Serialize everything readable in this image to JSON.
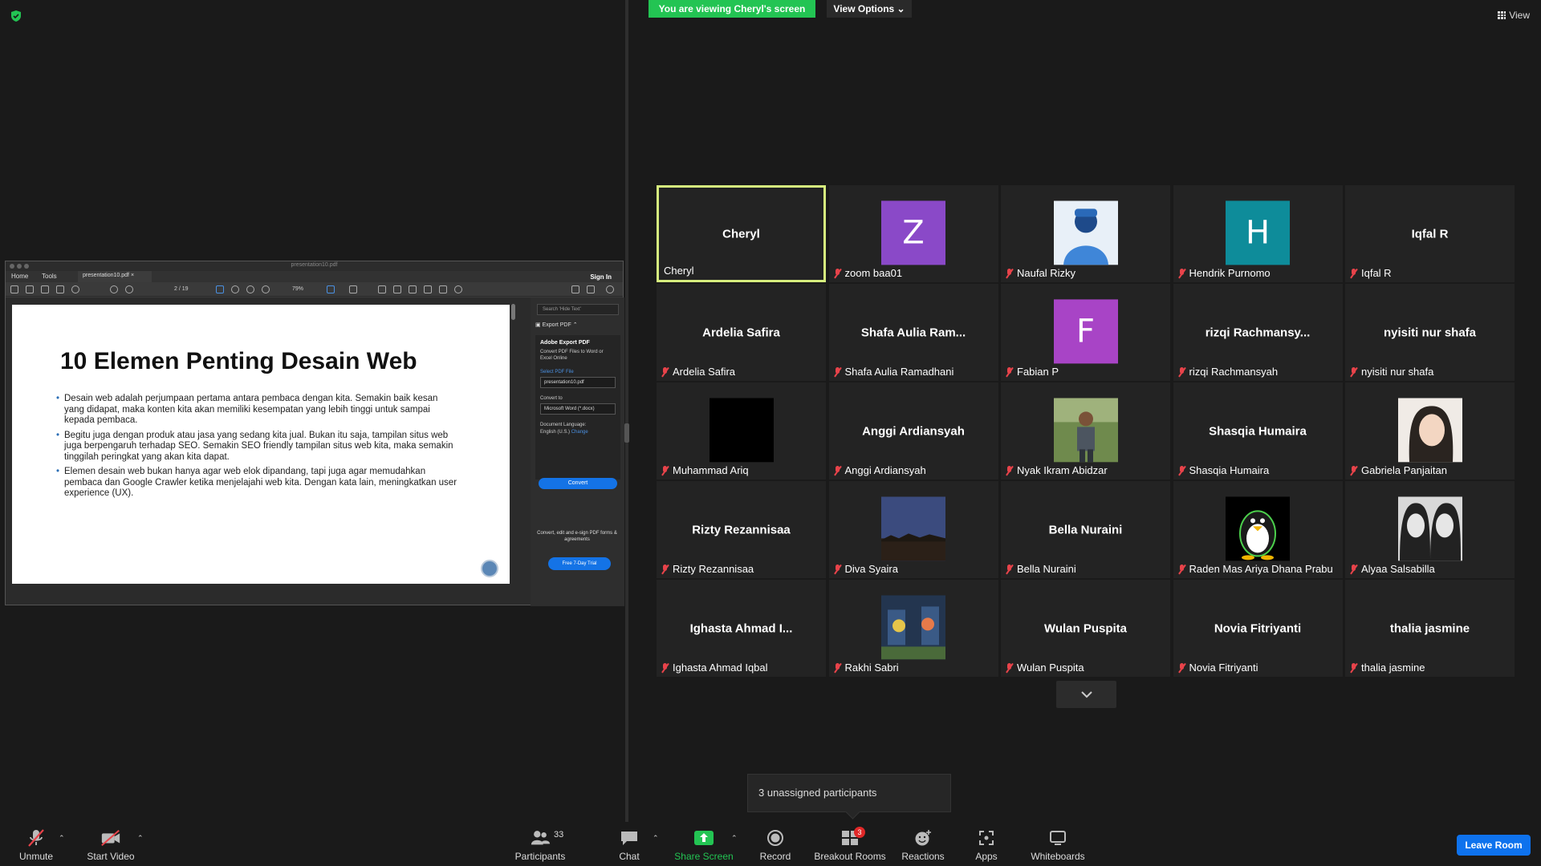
{
  "banner": {
    "viewing": "You are viewing Cheryl's screen",
    "view_options": "View Options ⌄",
    "view": "View"
  },
  "acrobat": {
    "window_title": "presentation10.pdf",
    "tabs": {
      "home": "Home",
      "tools": "Tools",
      "doc": "presentation10.pdf",
      "sign_in": "Sign In"
    },
    "page_num": "2 / 19",
    "zoom": "79%",
    "pdf": {
      "title": "10 Elemen Penting Desain Web",
      "bullets": [
        "Desain web adalah perjumpaan pertama antara pembaca dengan kita. Semakin baik kesan yang didapat, maka konten  kita akan memiliki kesempatan yang lebih tinggi untuk sampai kepada pembaca.",
        "Begitu juga dengan produk atau jasa yang sedang kita jual. Bukan itu saja, tampilan situs web juga berpengaruh terhadap SEO. Semakin SEO friendly tampilan situs web kita, maka semakin tinggilah peringkat yang akan kita dapat.",
        "Elemen desain web bukan hanya agar web elok dipandang, tapi juga agar memudahkan pembaca dan Google Crawler ketika menjelajahi web kita. Dengan kata lain, meningkatkan user experience (UX)."
      ]
    },
    "side": {
      "search_placeholder": "Search 'Hide Text'",
      "export_head": "Export PDF",
      "panel_title": "Adobe Export PDF",
      "panel_desc": "Convert PDF Files to Word or Excel Online",
      "select_label": "Select PDF File",
      "file": "presentation10.pdf",
      "convert_to_label": "Convert to",
      "convert_to": "Microsoft Word (*.docx)",
      "doc_lang_label": "Document Language:",
      "doc_lang": "English (U.S.)",
      "change": "Change",
      "convert_btn": "Convert",
      "promo": "Convert, edit and e-sign PDF forms & agreements",
      "trial_btn": "Free 7-Day Trial"
    }
  },
  "participants": [
    {
      "center": "Cheryl",
      "label": "Cheryl",
      "muted": false,
      "active": true
    },
    {
      "avatar": "Z",
      "color": "#8a49c8",
      "label": "zoom baa01",
      "muted": true
    },
    {
      "photo": "blue",
      "label": "Naufal Rizky",
      "muted": true
    },
    {
      "avatar": "H",
      "color": "#0e8c9a",
      "label": "Hendrik Purnomo",
      "muted": true
    },
    {
      "center": "Iqfal R",
      "label": "Iqfal R",
      "muted": true
    },
    {
      "center": "Ardelia Safira",
      "label": "Ardelia Safira",
      "muted": true
    },
    {
      "center": "Shafa  Aulia  Ram...",
      "label": "Shafa Aulia Ramadhani",
      "muted": true
    },
    {
      "avatar": "F",
      "color": "#a844c6",
      "label": "Fabian P",
      "muted": true
    },
    {
      "center": "rizqi  Rachmansy...",
      "label": "rizqi Rachmansyah",
      "muted": true
    },
    {
      "center": "nyisiti nur shafa",
      "label": "nyisiti nur shafa",
      "muted": true
    },
    {
      "photo": "black",
      "label": "Muhammad Ariq",
      "muted": true
    },
    {
      "center": "Anggi Ardiansyah",
      "label": "Anggi Ardiansyah",
      "muted": true
    },
    {
      "photo": "person",
      "label": "Nyak Ikram Abidzar",
      "muted": true
    },
    {
      "center": "Shasqia Humaira",
      "label": "Shasqia Humaira",
      "muted": true
    },
    {
      "photo": "girl",
      "label": "Gabriela Panjaitan",
      "muted": true
    },
    {
      "center": "Rizty Rezannisaa",
      "label": "Rizty Rezannisaa",
      "muted": true
    },
    {
      "photo": "night",
      "label": "Diva Syaira",
      "muted": true
    },
    {
      "center": "Bella Nuraini",
      "label": "Bella Nuraini",
      "muted": true
    },
    {
      "photo": "tux",
      "label": "Raden Mas Ariya Dhana Prabu",
      "muted": true
    },
    {
      "photo": "twins",
      "label": "Alyaa Salsabilla",
      "muted": true
    },
    {
      "center": "Ighasta Ahmad I...",
      "label": "Ighasta Ahmad Iqbal",
      "muted": true
    },
    {
      "photo": "cartoon",
      "label": "Rakhi Sabri",
      "muted": true
    },
    {
      "center": "Wulan Puspita",
      "label": "Wulan Puspita",
      "muted": true
    },
    {
      "center": "Novia Fitriyanti",
      "label": "Novia Fitriyanti",
      "muted": true
    },
    {
      "center": "thalia jasmine",
      "label": "thalia jasmine",
      "muted": true
    }
  ],
  "unassigned": "3 unassigned participants",
  "toolbar": {
    "unmute": "Unmute",
    "start_video": "Start Video",
    "participants": "Participants",
    "participants_count": "33",
    "chat": "Chat",
    "share_screen": "Share Screen",
    "record": "Record",
    "breakout_rooms": "Breakout Rooms",
    "breakout_badge": "3",
    "reactions": "Reactions",
    "apps": "Apps",
    "whiteboards": "Whiteboards",
    "leave": "Leave Room"
  }
}
